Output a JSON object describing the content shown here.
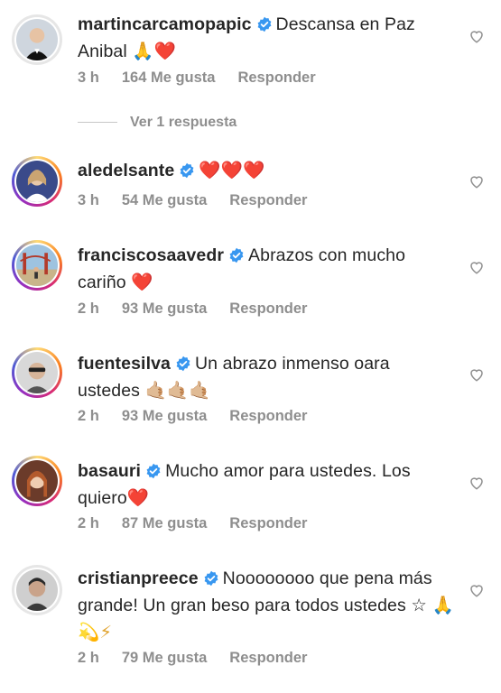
{
  "comments": [
    {
      "username": "martincarcamopapic",
      "text": "Descansa en Paz Anibal",
      "emoji": "🙏❤️",
      "time": "3 h",
      "likes": "164 Me gusta",
      "reply": "Responder"
    },
    {
      "username": "aledelsante",
      "text": "",
      "emoji": "❤️❤️❤️",
      "time": "3 h",
      "likes": "54 Me gusta",
      "reply": "Responder"
    },
    {
      "username": "franciscosaavedr",
      "text": "Abrazos con mucho cariño",
      "emoji": "❤️",
      "time": "2 h",
      "likes": "93 Me gusta",
      "reply": "Responder"
    },
    {
      "username": "fuentesilva",
      "text": "Un abrazo inmenso oara ustedes",
      "emoji": "🤙🏼🤙🏼🤙🏼",
      "time": "2 h",
      "likes": "93 Me gusta",
      "reply": "Responder"
    },
    {
      "username": "basauri",
      "text": "Mucho amor para ustedes. Los quiero",
      "emoji": "❤️",
      "time": "2 h",
      "likes": "87 Me gusta",
      "reply": "Responder"
    },
    {
      "username": "cristianpreece",
      "text": "Noooooooo que pena más grande! Un gran beso para todos ustedes ☆",
      "emoji": "🙏💫⚡",
      "time": "2 h",
      "likes": "79 Me gusta",
      "reply": "Responder"
    }
  ],
  "view_replies": "Ver 1 respuesta",
  "icons": {
    "verified": "verified-badge-icon",
    "like": "heart-outline-icon"
  },
  "colors": {
    "verified": "#3897f0",
    "meta": "#8e8e8e",
    "heart": "#e0245e"
  }
}
